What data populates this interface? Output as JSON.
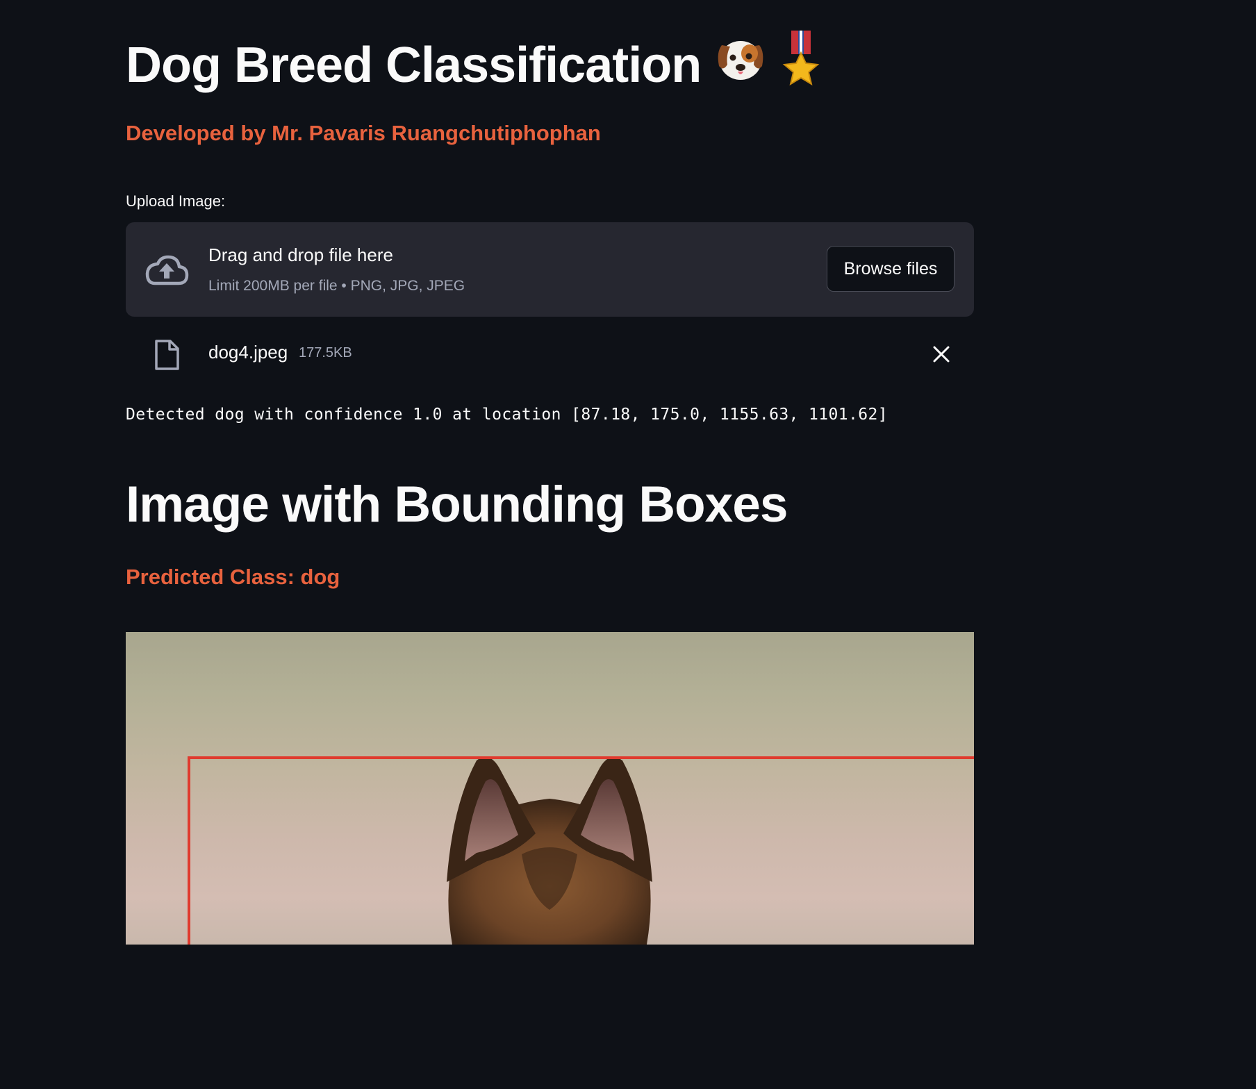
{
  "header": {
    "title": "Dog Breed Classification",
    "title_emojis": [
      "dog-face-icon",
      "medal-icon"
    ],
    "subtitle": "Developed by Mr. Pavaris Ruangchutiphophan"
  },
  "uploader": {
    "label": "Upload Image:",
    "dropzone_title": "Drag and drop file here",
    "dropzone_limit": "Limit 200MB per file • PNG, JPG, JPEG",
    "browse_label": "Browse files",
    "file": {
      "name": "dog4.jpeg",
      "size": "177.5KB"
    }
  },
  "detection": {
    "text": "Detected dog with confidence 1.0 at location [87.18, 175.0, 1155.63, 1101.62]"
  },
  "result": {
    "heading": "Image with Bounding Boxes",
    "predicted": "Predicted Class: dog",
    "box_color": "#e03a2e"
  },
  "colors": {
    "background": "#0e1117",
    "accent": "#e8623e",
    "dropzone": "#262730"
  }
}
